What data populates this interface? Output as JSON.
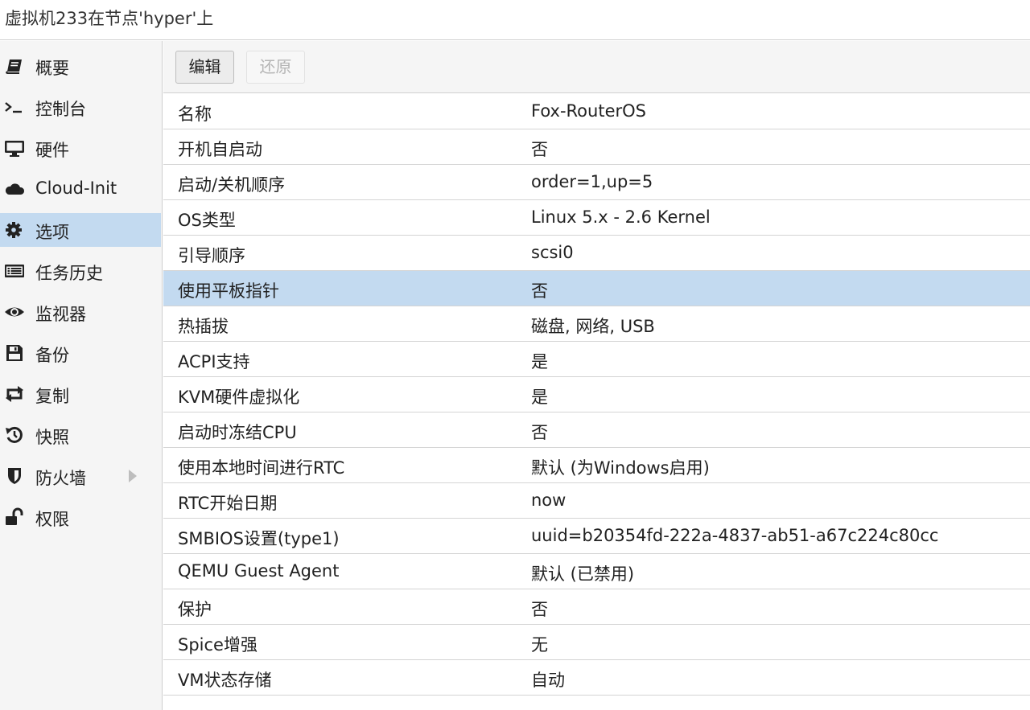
{
  "window": {
    "title": "虚拟机233在节点'hyper'上"
  },
  "sidebar": {
    "items": [
      {
        "label": "概要",
        "icon": "book-icon"
      },
      {
        "label": "控制台",
        "icon": "terminal-icon"
      },
      {
        "label": "硬件",
        "icon": "monitor-icon"
      },
      {
        "label": "Cloud-Init",
        "icon": "cloud-icon"
      },
      {
        "label": "选项",
        "icon": "gear-icon",
        "selected": true
      },
      {
        "label": "任务历史",
        "icon": "list-icon"
      },
      {
        "label": "监视器",
        "icon": "eye-icon"
      },
      {
        "label": "备份",
        "icon": "floppy-icon"
      },
      {
        "label": "复制",
        "icon": "retweet-icon"
      },
      {
        "label": "快照",
        "icon": "history-icon"
      },
      {
        "label": "防火墙",
        "icon": "shield-icon",
        "expandable": true
      },
      {
        "label": "权限",
        "icon": "unlock-icon"
      }
    ]
  },
  "toolbar": {
    "edit_label": "编辑",
    "revert_label": "还原"
  },
  "options": {
    "rows": [
      {
        "key": "名称",
        "value": "Fox-RouterOS"
      },
      {
        "key": "开机自启动",
        "value": "否"
      },
      {
        "key": "启动/关机顺序",
        "value": "order=1,up=5"
      },
      {
        "key": "OS类型",
        "value": "Linux 5.x - 2.6 Kernel"
      },
      {
        "key": "引导顺序",
        "value": "scsi0"
      },
      {
        "key": "使用平板指针",
        "value": "否",
        "selected": true
      },
      {
        "key": "热插拔",
        "value": "磁盘, 网络, USB"
      },
      {
        "key": "ACPI支持",
        "value": "是"
      },
      {
        "key": "KVM硬件虚拟化",
        "value": "是"
      },
      {
        "key": "启动时冻结CPU",
        "value": "否"
      },
      {
        "key": "使用本地时间进行RTC",
        "value": "默认 (为Windows启用)"
      },
      {
        "key": "RTC开始日期",
        "value": "now"
      },
      {
        "key": "SMBIOS设置(type1)",
        "value": "uuid=b20354fd-222a-4837-ab51-a67c224c80cc"
      },
      {
        "key": "QEMU Guest Agent",
        "value": "默认 (已禁用)"
      },
      {
        "key": "保护",
        "value": "否"
      },
      {
        "key": "Spice增强",
        "value": "无"
      },
      {
        "key": "VM状态存储",
        "value": "自动"
      }
    ]
  },
  "colors": {
    "selection": "#c3daf0",
    "sidebar_bg": "#f5f5f5",
    "border": "#cfcfcf"
  }
}
